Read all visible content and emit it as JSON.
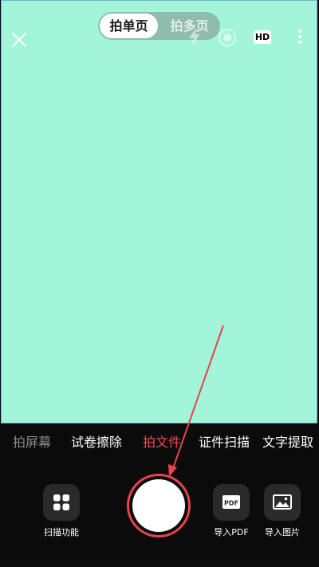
{
  "top_bar": {
    "close_icon": "close-icon",
    "mode_toggle": {
      "single": "拍单页",
      "multi": "拍多页",
      "selected": "拍单页"
    },
    "flash_icon": "flash-icon",
    "focus_icon": "focus-icon",
    "hd_label": "HD",
    "more_icon": "more-vertical-icon"
  },
  "preview": {
    "color": "#a3f5d9"
  },
  "modes": [
    {
      "label": "拍屏幕",
      "state": "dim"
    },
    {
      "label": "试卷擦除",
      "state": "normal"
    },
    {
      "label": "拍文件",
      "state": "selected"
    },
    {
      "label": "证件扫描",
      "state": "normal"
    },
    {
      "label": "文字提取",
      "state": "normal"
    }
  ],
  "bottom": {
    "scan_functions": {
      "label": "扫描功能",
      "icon": "grid-icon"
    },
    "import_pdf": {
      "label": "导入PDF",
      "icon": "pdf-icon",
      "badge": "PDF"
    },
    "import_image": {
      "label": "导入图片",
      "icon": "image-icon"
    },
    "shutter_icon": "shutter-button"
  },
  "colors": {
    "accent": "#e8434e",
    "selected_mode": "#f0504b"
  }
}
